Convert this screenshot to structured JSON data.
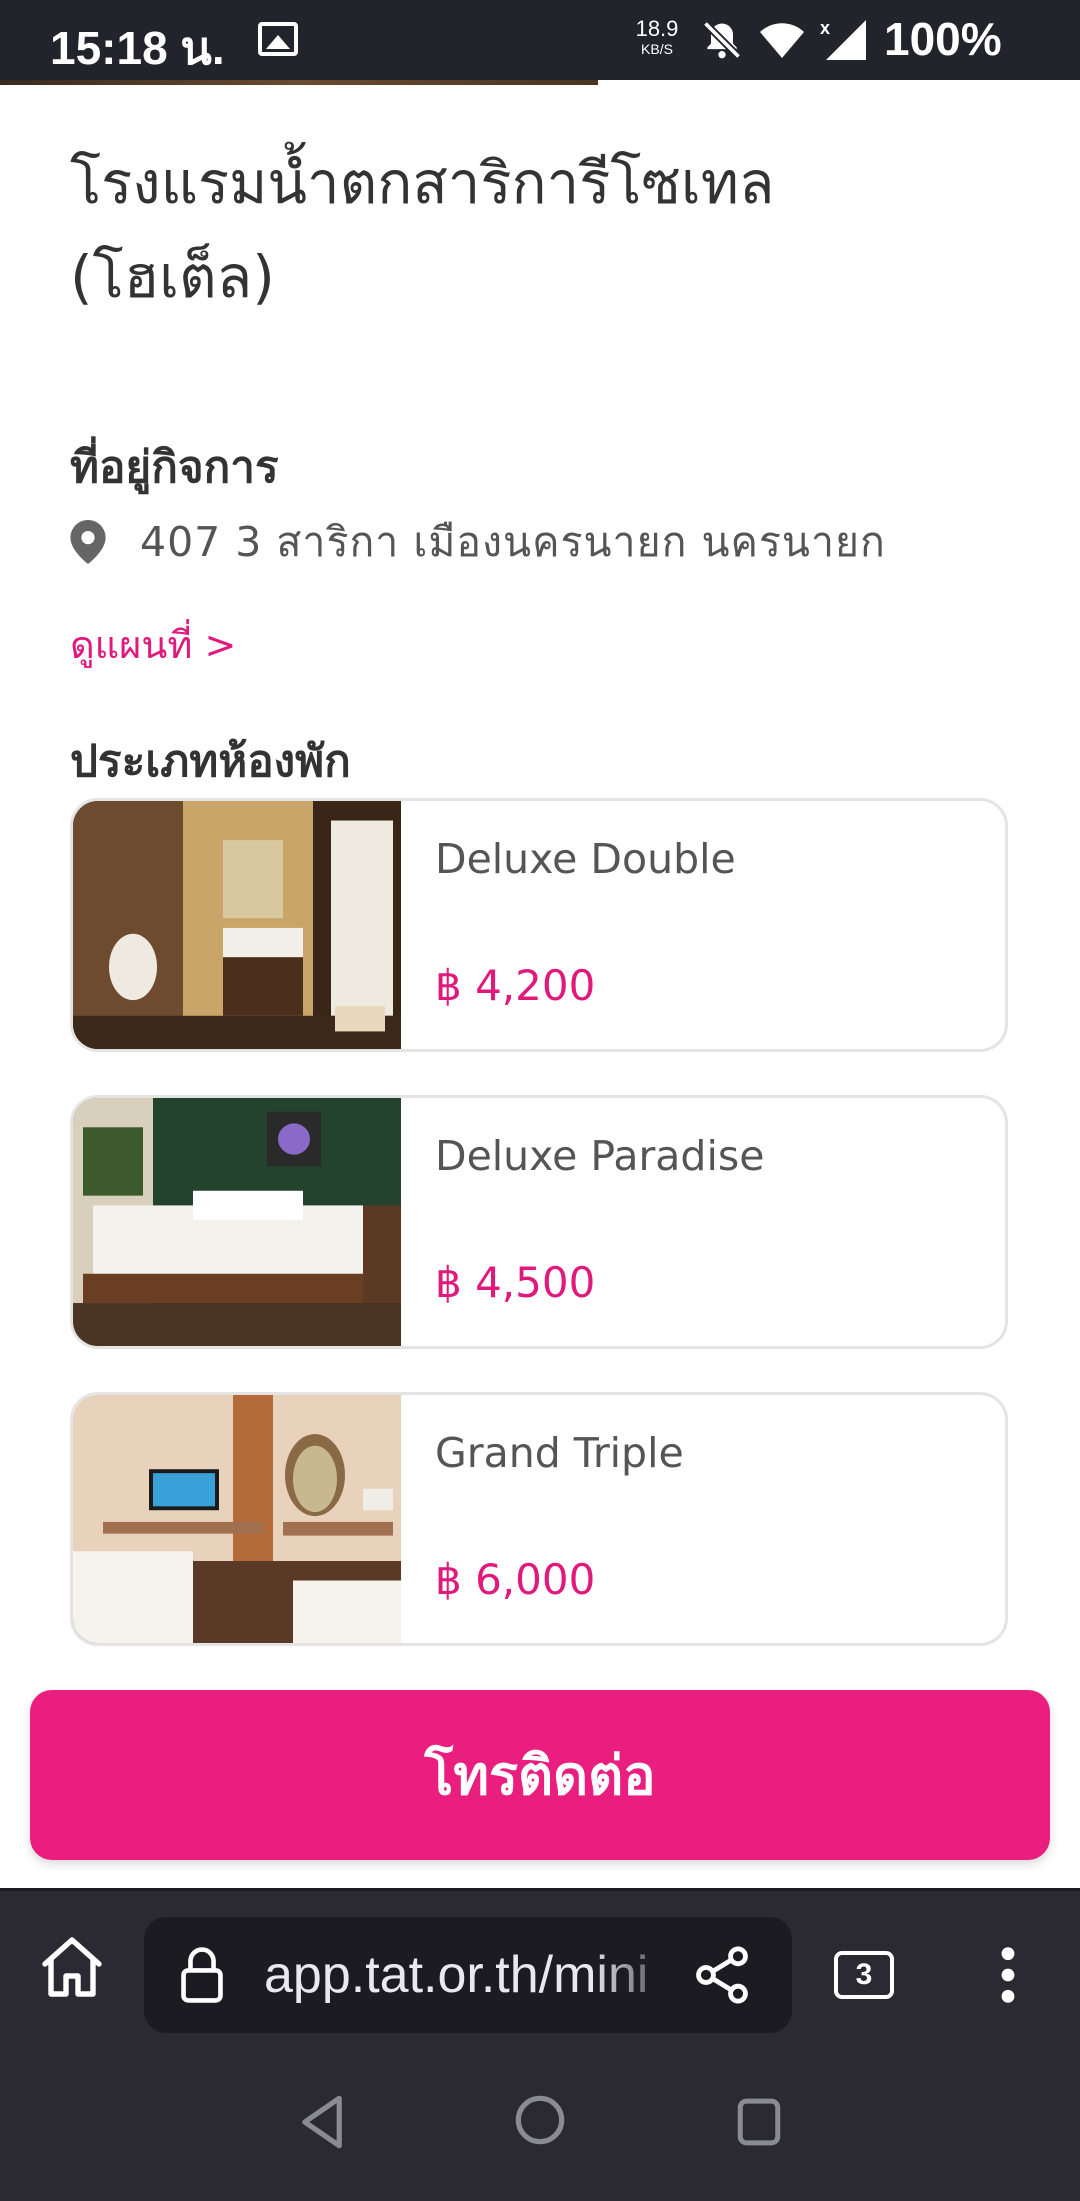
{
  "status_bar": {
    "time": "15:18 น.",
    "net_speed_value": "18.9",
    "net_speed_unit": "KB/S",
    "battery": "100%"
  },
  "hotel": {
    "title_line1": "โรงแรมน้ำตกสาริการีโซเทล",
    "title_line2": "(โฮเต็ล)"
  },
  "address_section": {
    "heading": "ที่อยู่กิจการ",
    "address": "407  3    สาริกา เมืองนครนายก นครนายก",
    "map_link": "ดูแผนที่ >"
  },
  "rooms_section": {
    "heading": "ประเภทห้องพัก",
    "rooms": [
      {
        "name": "Deluxe Double",
        "price": "฿ 4,200"
      },
      {
        "name": "Deluxe Paradise",
        "price": "฿ 4,500"
      },
      {
        "name": "Grand Triple",
        "price": "฿ 6,000"
      }
    ]
  },
  "call_button": {
    "label": "โทรติดต่อ"
  },
  "browser": {
    "url": "app.tat.or.th/mini",
    "tab_count": "3"
  },
  "colors": {
    "accent": "#e91e7f",
    "price": "#e0197d",
    "browser_bg": "#2b2a33"
  }
}
